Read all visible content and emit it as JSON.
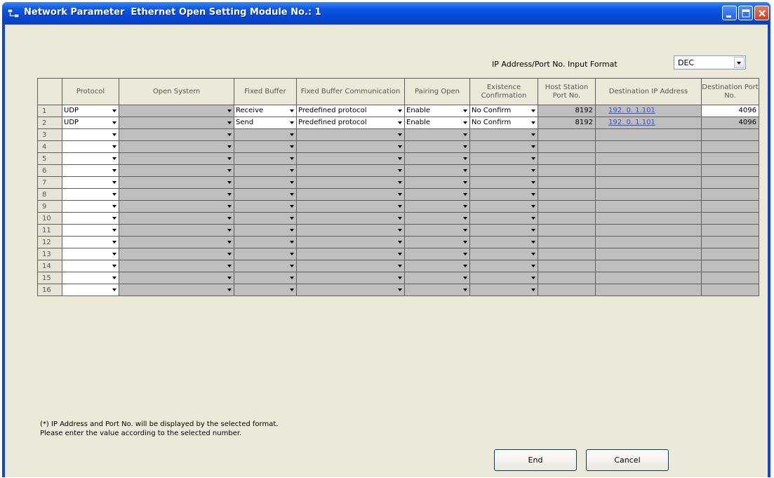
{
  "window": {
    "title": "Network Parameter  Ethernet Open Setting Module No.: 1"
  },
  "input_format": {
    "label": "IP Address/Port No. Input Format",
    "value": "DEC"
  },
  "columns": [
    "",
    "Protocol",
    "Open System",
    "Fixed Buffer",
    "Fixed Buffer Communication",
    "Pairing Open",
    "Existence Confirmation",
    "Host Station Port No.",
    "Destination IP Address",
    "Destination Port No."
  ],
  "rows": [
    {
      "no": "1",
      "protocol": "UDP",
      "open_system": "",
      "fixed_buffer": "Receive",
      "fb_comm": "Predefined protocol",
      "pairing": "Enable",
      "existence": "No Confirm",
      "host_port": "8192",
      "dest_ip": "192.  0.  1.101",
      "dest_port": "4096"
    },
    {
      "no": "2",
      "protocol": "UDP",
      "open_system": "",
      "fixed_buffer": "Send",
      "fb_comm": "Predefined protocol",
      "pairing": "Enable",
      "existence": "No Confirm",
      "host_port": "8192",
      "dest_ip": "192.  0.  1.101",
      "dest_port": "4096"
    },
    {
      "no": "3",
      "protocol": "",
      "open_system": "",
      "fixed_buffer": "",
      "fb_comm": "",
      "pairing": "",
      "existence": "",
      "host_port": "",
      "dest_ip": "",
      "dest_port": ""
    },
    {
      "no": "4",
      "protocol": "",
      "open_system": "",
      "fixed_buffer": "",
      "fb_comm": "",
      "pairing": "",
      "existence": "",
      "host_port": "",
      "dest_ip": "",
      "dest_port": ""
    },
    {
      "no": "5",
      "protocol": "",
      "open_system": "",
      "fixed_buffer": "",
      "fb_comm": "",
      "pairing": "",
      "existence": "",
      "host_port": "",
      "dest_ip": "",
      "dest_port": ""
    },
    {
      "no": "6",
      "protocol": "",
      "open_system": "",
      "fixed_buffer": "",
      "fb_comm": "",
      "pairing": "",
      "existence": "",
      "host_port": "",
      "dest_ip": "",
      "dest_port": ""
    },
    {
      "no": "7",
      "protocol": "",
      "open_system": "",
      "fixed_buffer": "",
      "fb_comm": "",
      "pairing": "",
      "existence": "",
      "host_port": "",
      "dest_ip": "",
      "dest_port": ""
    },
    {
      "no": "8",
      "protocol": "",
      "open_system": "",
      "fixed_buffer": "",
      "fb_comm": "",
      "pairing": "",
      "existence": "",
      "host_port": "",
      "dest_ip": "",
      "dest_port": ""
    },
    {
      "no": "9",
      "protocol": "",
      "open_system": "",
      "fixed_buffer": "",
      "fb_comm": "",
      "pairing": "",
      "existence": "",
      "host_port": "",
      "dest_ip": "",
      "dest_port": ""
    },
    {
      "no": "10",
      "protocol": "",
      "open_system": "",
      "fixed_buffer": "",
      "fb_comm": "",
      "pairing": "",
      "existence": "",
      "host_port": "",
      "dest_ip": "",
      "dest_port": ""
    },
    {
      "no": "11",
      "protocol": "",
      "open_system": "",
      "fixed_buffer": "",
      "fb_comm": "",
      "pairing": "",
      "existence": "",
      "host_port": "",
      "dest_ip": "",
      "dest_port": ""
    },
    {
      "no": "12",
      "protocol": "",
      "open_system": "",
      "fixed_buffer": "",
      "fb_comm": "",
      "pairing": "",
      "existence": "",
      "host_port": "",
      "dest_ip": "",
      "dest_port": ""
    },
    {
      "no": "13",
      "protocol": "",
      "open_system": "",
      "fixed_buffer": "",
      "fb_comm": "",
      "pairing": "",
      "existence": "",
      "host_port": "",
      "dest_ip": "",
      "dest_port": ""
    },
    {
      "no": "14",
      "protocol": "",
      "open_system": "",
      "fixed_buffer": "",
      "fb_comm": "",
      "pairing": "",
      "existence": "",
      "host_port": "",
      "dest_ip": "",
      "dest_port": ""
    },
    {
      "no": "15",
      "protocol": "",
      "open_system": "",
      "fixed_buffer": "",
      "fb_comm": "",
      "pairing": "",
      "existence": "",
      "host_port": "",
      "dest_ip": "",
      "dest_port": ""
    },
    {
      "no": "16",
      "protocol": "",
      "open_system": "",
      "fixed_buffer": "",
      "fb_comm": "",
      "pairing": "",
      "existence": "",
      "host_port": "",
      "dest_ip": "",
      "dest_port": ""
    }
  ],
  "note": {
    "line1": "(*) IP Address and Port No. will be displayed by the selected format.",
    "line2": "Please enter the value according to the selected number."
  },
  "buttons": {
    "end": "End",
    "cancel": "Cancel"
  },
  "icons": {
    "title": "network-parameter-icon",
    "minimize": "minimize-icon",
    "maximize": "maximize-icon",
    "close": "close-icon",
    "dropdown": "chevron-down-icon"
  },
  "colors": {
    "titlebar": "#0846d4",
    "client": "#ece9d8",
    "disabled_cell": "#bfbfbf",
    "link": "#3a52c8"
  }
}
